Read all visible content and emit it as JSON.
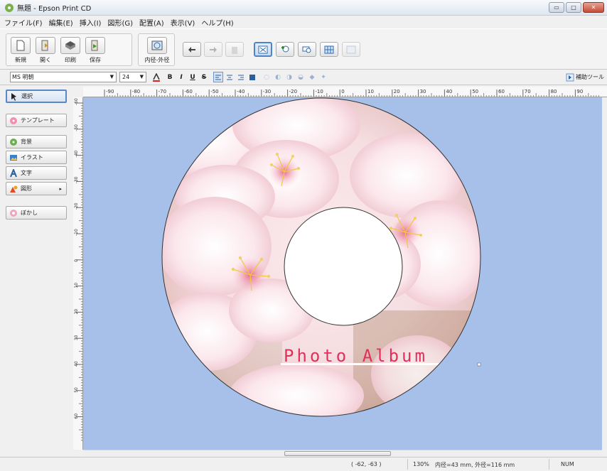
{
  "window": {
    "title": "無題 - Epson Print CD",
    "minimize_label": "▭",
    "maximize_label": "□",
    "close_label": "✕"
  },
  "menu": [
    "ファイル(F)",
    "編集(E)",
    "挿入(I)",
    "図形(G)",
    "配置(A)",
    "表示(V)",
    "ヘルプ(H)"
  ],
  "toolbar": {
    "buttons": [
      {
        "label": "新規",
        "icon": "new-document-icon"
      },
      {
        "label": "開く",
        "icon": "open-icon"
      },
      {
        "label": "印刷",
        "icon": "print-icon"
      },
      {
        "label": "保存",
        "icon": "save-icon"
      },
      {
        "label": "内径-外径",
        "icon": "diameter-icon"
      }
    ]
  },
  "format": {
    "font": "MS 明朝",
    "size": "24",
    "bold": "B",
    "italic": "I",
    "underline": "U",
    "strike": "S",
    "aux_tool": "補助ツール"
  },
  "sidebar": {
    "items": [
      {
        "label": "選択",
        "icon": "select-arrow-icon"
      },
      {
        "label": "テンプレート",
        "icon": "template-icon"
      },
      {
        "label": "背景",
        "icon": "background-icon"
      },
      {
        "label": "イラスト",
        "icon": "illustration-icon"
      },
      {
        "label": "文字",
        "icon": "text-icon"
      },
      {
        "label": "図形",
        "icon": "shape-icon"
      },
      {
        "label": "ぼかし",
        "icon": "blur-icon"
      }
    ]
  },
  "ruler": {
    "h_labels": [
      "-90",
      "-80",
      "-70",
      "-60",
      "-50",
      "-40",
      "-30",
      "-20",
      "-10",
      "0",
      "10",
      "20",
      "30",
      "40",
      "50",
      "60",
      "70",
      "80",
      "90"
    ],
    "v_labels": [
      "-60",
      "-50",
      "-40",
      "-30",
      "-20",
      "-10",
      "0",
      "10",
      "20",
      "30",
      "40",
      "50",
      "60"
    ]
  },
  "disc": {
    "text": "Photo Album",
    "text_color": "#e0305c",
    "background_color": "#a7c0ea"
  },
  "status": {
    "coords": "( -62, -63 )",
    "zoom": "130%",
    "diameter": "内径=43 mm, 外径=116 mm",
    "num": "NUM"
  }
}
